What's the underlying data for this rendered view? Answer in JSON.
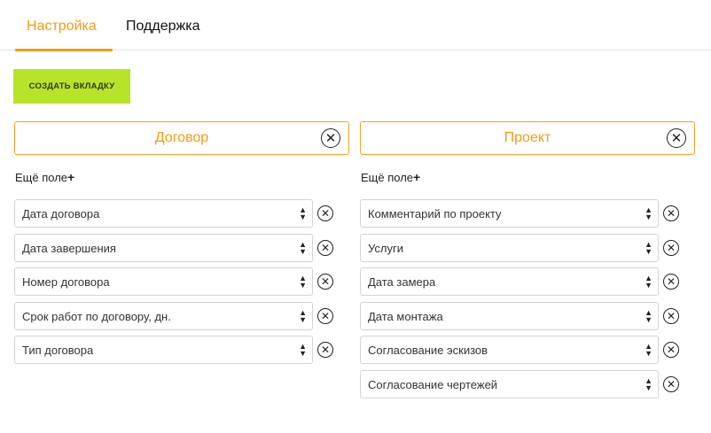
{
  "tabs": [
    {
      "label": "Настройка"
    },
    {
      "label": "Поддержка"
    }
  ],
  "create_button": "СОЗДАТЬ ВКЛАДКУ",
  "columns": [
    {
      "title": "Договор",
      "more_label": "Ещё поле",
      "fields": [
        "Дата договора",
        "Дата завершения",
        "Номер договора",
        "Срок работ по договору, дн.",
        "Тип договора"
      ]
    },
    {
      "title": "Проект",
      "more_label": "Ещё поле",
      "fields": [
        "Комментарий по проекту",
        "Услуги",
        "Дата замера",
        "Дата монтажа",
        "Согласование эскизов",
        "Согласование чертежей"
      ]
    }
  ],
  "icons": {
    "close": "circle-x-icon",
    "add": "plus-icon",
    "select": "up-down-arrows-icon"
  },
  "colors": {
    "accent": "#f39c12",
    "button_bg": "#b7e32a"
  }
}
